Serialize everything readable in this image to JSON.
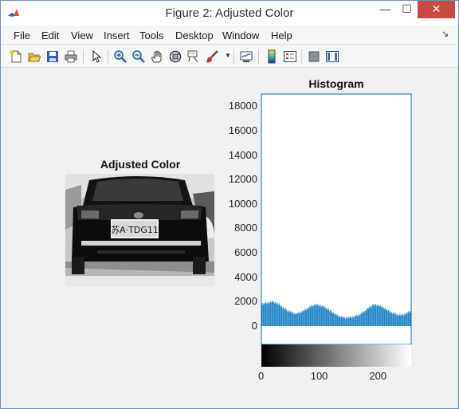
{
  "window": {
    "title": "Figure 2: Adjusted Color"
  },
  "window_controls": {
    "minimize": "—",
    "maximize": "☐",
    "close": "✕"
  },
  "menu": [
    "File",
    "Edit",
    "View",
    "Insert",
    "Tools",
    "Desktop",
    "Window",
    "Help"
  ],
  "menu_more": "↘",
  "toolbar_icons": [
    "new-figure-icon",
    "open-file-icon",
    "save-icon",
    "print-icon",
    "pointer-icon",
    "zoom-in-icon",
    "zoom-out-icon",
    "pan-hand-icon",
    "rotate-3d-icon",
    "data-cursor-icon",
    "brush-icon",
    "link-plot-icon",
    "colorbar-icon",
    "legend-icon",
    "hide-plot-tools-icon",
    "show-plot-tools-icon"
  ],
  "colors": {
    "bar_blue": "#0072bd",
    "close_red": "#c74b43",
    "axis_edge": "#0072bd"
  },
  "image_panel": {
    "title": "Adjusted Color",
    "plate_text": "苏A·TDG11"
  },
  "chart_data": {
    "type": "bar",
    "title": "Histogram",
    "xlabel": "",
    "ylabel": "",
    "ylim": [
      -1500,
      19000
    ],
    "xlim": [
      0,
      255
    ],
    "yticks": [
      0,
      2000,
      4000,
      6000,
      8000,
      10000,
      12000,
      14000,
      16000,
      18000
    ],
    "xticks": [
      0,
      100,
      200
    ],
    "ytick_labels": [
      "0",
      "2000",
      "4000",
      "6000",
      "8000",
      "10000",
      "12000",
      "14000",
      "16000",
      "18000"
    ],
    "xtick_labels": [
      "0",
      "100",
      "200"
    ],
    "grayscale_colorbar": true,
    "bins": 256,
    "profile": [
      [
        0,
        1800
      ],
      [
        10,
        1900
      ],
      [
        20,
        2000
      ],
      [
        30,
        1800
      ],
      [
        40,
        1400
      ],
      [
        50,
        1150
      ],
      [
        60,
        1000
      ],
      [
        70,
        1200
      ],
      [
        80,
        1500
      ],
      [
        90,
        1750
      ],
      [
        100,
        1700
      ],
      [
        110,
        1500
      ],
      [
        120,
        1150
      ],
      [
        130,
        850
      ],
      [
        140,
        700
      ],
      [
        150,
        700
      ],
      [
        160,
        800
      ],
      [
        170,
        1000
      ],
      [
        180,
        1400
      ],
      [
        190,
        1750
      ],
      [
        200,
        1700
      ],
      [
        210,
        1450
      ],
      [
        220,
        1150
      ],
      [
        230,
        950
      ],
      [
        240,
        900
      ],
      [
        250,
        1100
      ],
      [
        255,
        1300
      ]
    ]
  }
}
